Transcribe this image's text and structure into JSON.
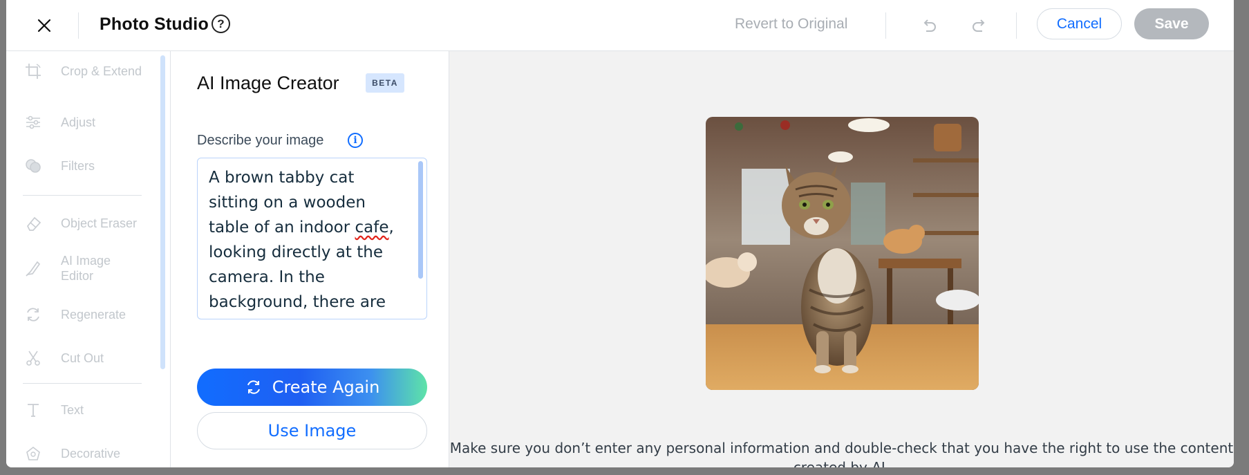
{
  "header": {
    "title": "Photo Studio",
    "help": "?",
    "revert_label": "Revert to Original",
    "cancel_label": "Cancel",
    "save_label": "Save"
  },
  "tools": {
    "items": [
      {
        "label": "Crop & Extend",
        "icon": "crop-extend-icon"
      },
      {
        "label": "Adjust",
        "icon": "sliders-icon"
      },
      {
        "label": "Filters",
        "icon": "filters-icon"
      },
      {
        "label": "Object Eraser",
        "icon": "eraser-icon"
      },
      {
        "label": "AI Image Editor",
        "icon": "ai-brush-icon"
      },
      {
        "label": "Regenerate",
        "icon": "regenerate-icon"
      },
      {
        "label": "Cut Out",
        "icon": "scissors-icon"
      },
      {
        "label": "Text",
        "icon": "text-icon"
      },
      {
        "label": "Decorative",
        "icon": "decorative-icon"
      }
    ]
  },
  "panel": {
    "title": "AI Image Creator",
    "badge": "BETA",
    "field_label": "Describe your image",
    "prompt_before": "A brown tabby cat sitting on a wooden table of an indoor ",
    "prompt_misspelled": "cafe",
    "prompt_after": ", looking directly at the camera. In the background, there are other cats playing",
    "create_label": "Create Again",
    "use_label": "Use Image"
  },
  "preview": {
    "image_subject": "brown tabby cat sitting on a wooden table in a cat cafe",
    "disclaimer": "Make sure you don’t enter any personal information and double-check that you have the right to use the content created by AI."
  },
  "colors": {
    "accent": "#116dff",
    "save_disabled": "#b4b8bd",
    "tool_disabled": "#c2c7cc",
    "badge_bg": "#d6e6fe",
    "preview_bg": "#f2f2f2"
  }
}
